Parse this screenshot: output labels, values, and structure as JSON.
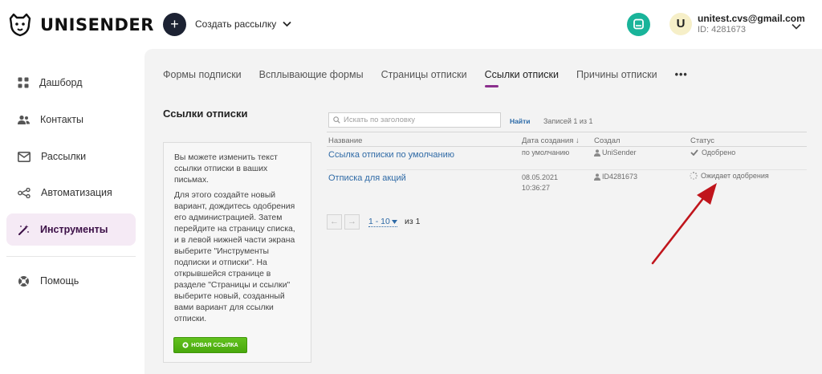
{
  "header": {
    "logo_text": "UNISENDER",
    "create_label": "Создать рассылку",
    "user": {
      "initial": "U",
      "email": "unitest.cvs@gmail.com",
      "id": "ID: 4281673"
    }
  },
  "sidebar": {
    "items": [
      {
        "label": "Дашборд",
        "icon": "grid-icon"
      },
      {
        "label": "Контакты",
        "icon": "people-icon"
      },
      {
        "label": "Рассылки",
        "icon": "mail-icon"
      },
      {
        "label": "Автоматизация",
        "icon": "flow-icon"
      },
      {
        "label": "Инструменты",
        "icon": "magic-wand-icon",
        "active": true
      },
      {
        "label": "Помощь",
        "icon": "lifebuoy-icon"
      }
    ]
  },
  "tabs": [
    {
      "label": "Формы подписки"
    },
    {
      "label": "Всплывающие формы"
    },
    {
      "label": "Страницы отписки"
    },
    {
      "label": "Ссылки отписки",
      "active": true
    },
    {
      "label": "Причины отписки"
    },
    {
      "label": "•••"
    }
  ],
  "section": {
    "title": "Ссылки отписки",
    "info_p1": "Вы можете изменить текст ссылки отписки в ваших письмах.",
    "info_p2": "Для этого создайте новый вариант, дождитесь одобрения его администрацией. Затем перейдите на страницу списка, и в левой нижней части экрана выберите \"Инструменты подписки и отписки\". На открывшейся странице в разделе \"Страницы и ссылки\" выберите новый, созданный вами вариант для ссылки отписки.",
    "new_link_label": "НОВАЯ ССЫЛКА"
  },
  "search": {
    "placeholder": "Искать по заголовку",
    "find_label": "Найти",
    "records": "Записей 1 из 1"
  },
  "table": {
    "headers": {
      "name": "Название",
      "date": "Дата создания",
      "date_sort": "↓",
      "creator": "Создал",
      "status": "Статус"
    },
    "rows": [
      {
        "name": "Ссылка отписки по умолчанию",
        "date": "по умолчанию",
        "time": "",
        "creator": "UniSender",
        "status": "Одобрено",
        "status_icon": "check-icon"
      },
      {
        "name": "Отписка для акций",
        "date": "08.05.2021",
        "time": "10:36:27",
        "creator": "ID4281673",
        "status": "Ожидает одобрения",
        "status_icon": "spinner-icon"
      }
    ]
  },
  "pagination": {
    "prev": "←",
    "next": "→",
    "range": "1 - 10",
    "of": "из 1"
  },
  "colors": {
    "accent": "#8b2f8d",
    "active_bg": "#f5eaf5",
    "link": "#2f6aa6",
    "button_green": "#49a80d",
    "arrow_red": "#c0151c",
    "help_teal": "#19b49a"
  }
}
